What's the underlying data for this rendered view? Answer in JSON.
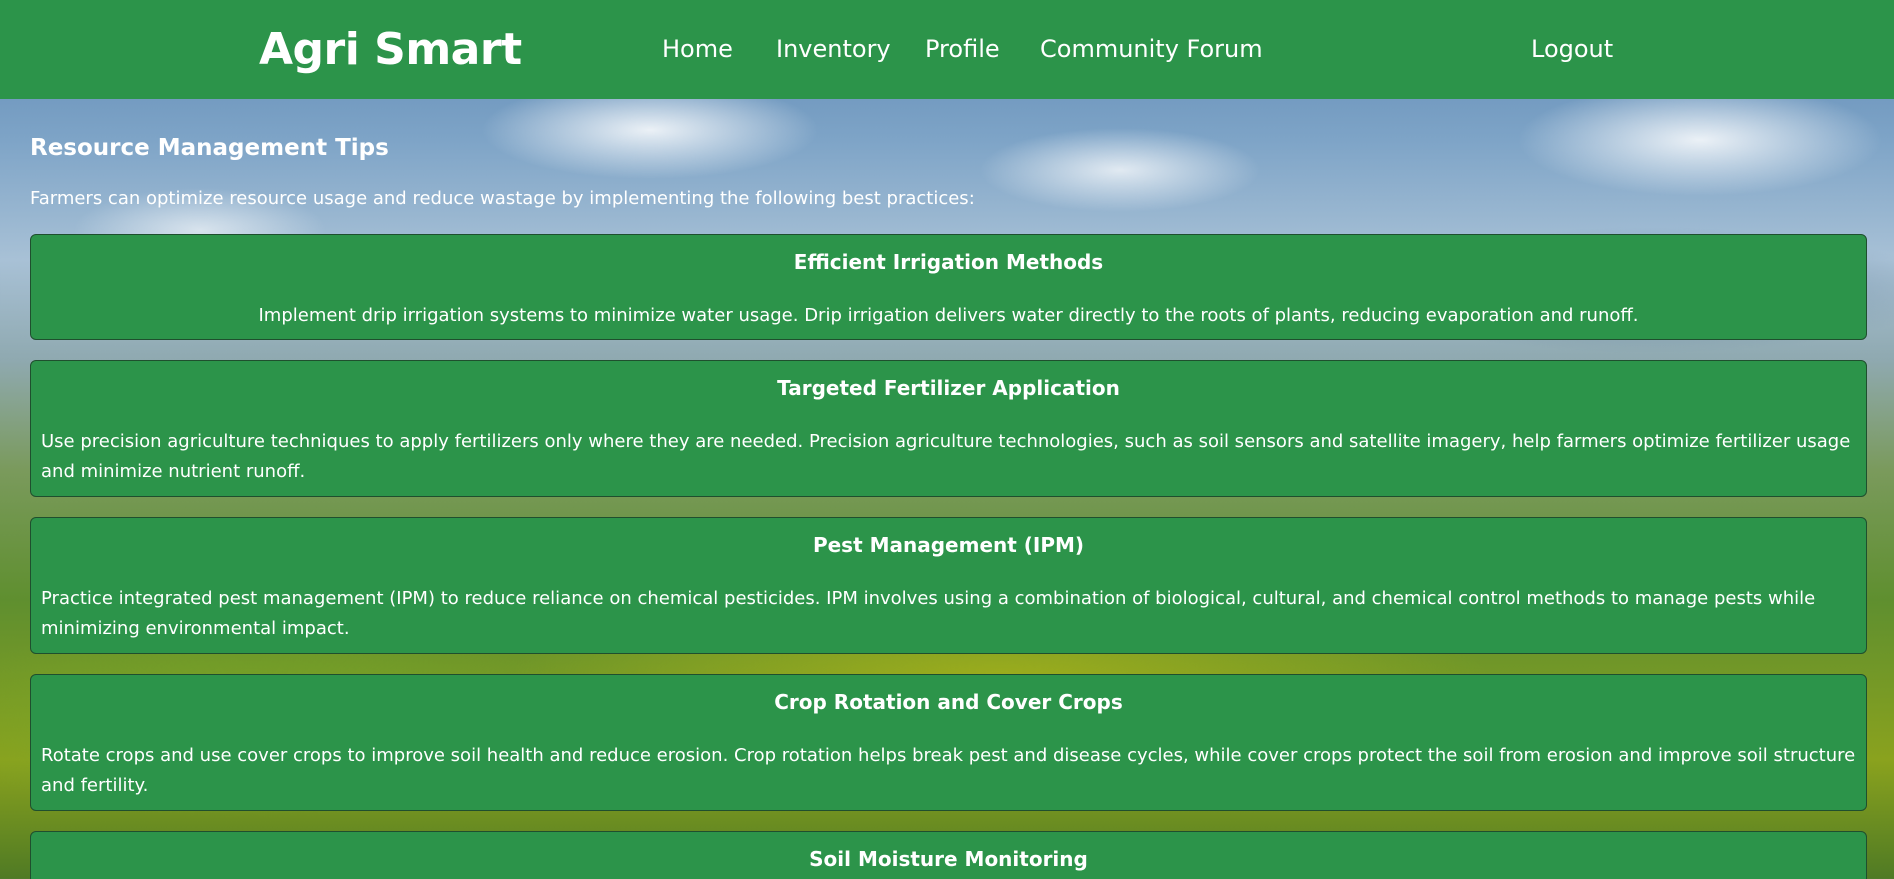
{
  "nav": {
    "brand": "Agri Smart",
    "links": [
      "Home",
      "Inventory",
      "Profile",
      "Community Forum"
    ],
    "logout": "Logout"
  },
  "main": {
    "title": "Resource Management Tips",
    "intro": "Farmers can optimize resource usage and reduce wastage by implementing the following best practices:",
    "tips": [
      {
        "title": "Efficient Irrigation Methods",
        "text": "Implement drip irrigation systems to minimize water usage. Drip irrigation delivers water directly to the roots of plants, reducing evaporation and runoff."
      },
      {
        "title": "Targeted Fertilizer Application",
        "text": "Use precision agriculture techniques to apply fertilizers only where they are needed. Precision agriculture technologies, such as soil sensors and satellite imagery, help farmers optimize fertilizer usage and minimize nutrient runoff."
      },
      {
        "title": "Pest Management (IPM)",
        "text": "Practice integrated pest management (IPM) to reduce reliance on chemical pesticides. IPM involves using a combination of biological, cultural, and chemical control methods to manage pests while minimizing environmental impact."
      },
      {
        "title": "Crop Rotation and Cover Crops",
        "text": "Rotate crops and use cover crops to improve soil health and reduce erosion. Crop rotation helps break pest and disease cycles, while cover crops protect the soil from erosion and improve soil structure and fertility."
      },
      {
        "title": "Soil Moisture Monitoring",
        "text": ""
      }
    ]
  },
  "colors": {
    "nav_background": "#2c944a",
    "card_background": "#2c944a",
    "text": "#ffffff"
  }
}
